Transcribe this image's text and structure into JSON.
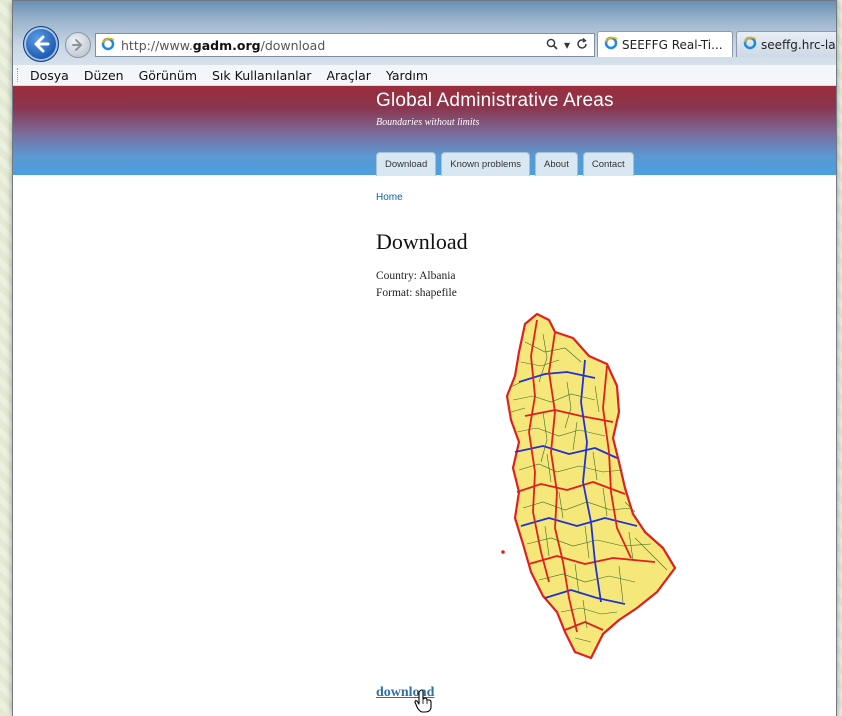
{
  "browser": {
    "url_prefix": "http://www.",
    "url_domain": "gadm.org",
    "url_path": "/download",
    "tabs": [
      {
        "label": "SEEFFG Real-Ti..."
      },
      {
        "label": "seeffg.hrc-lab."
      }
    ],
    "menu": [
      "Dosya",
      "Düzen",
      "Görünüm",
      "Sık Kullanılanlar",
      "Araçlar",
      "Yardım"
    ]
  },
  "site": {
    "title": "Global Administrative Areas",
    "slogan": "Boundaries without limits",
    "nav_tabs": [
      "Download",
      "Known problems",
      "About",
      "Contact"
    ],
    "breadcrumb": "Home"
  },
  "content": {
    "heading": "Download",
    "country": "Country: Albania",
    "format": "Format: shapefile",
    "download_link": "download"
  },
  "colors": {
    "map_fill": "#f5e77a",
    "map_border_red": "#e0201f",
    "map_border_blue": "#2233d0",
    "map_border_green": "#3a6a2a",
    "link": "#2f6fa8"
  }
}
